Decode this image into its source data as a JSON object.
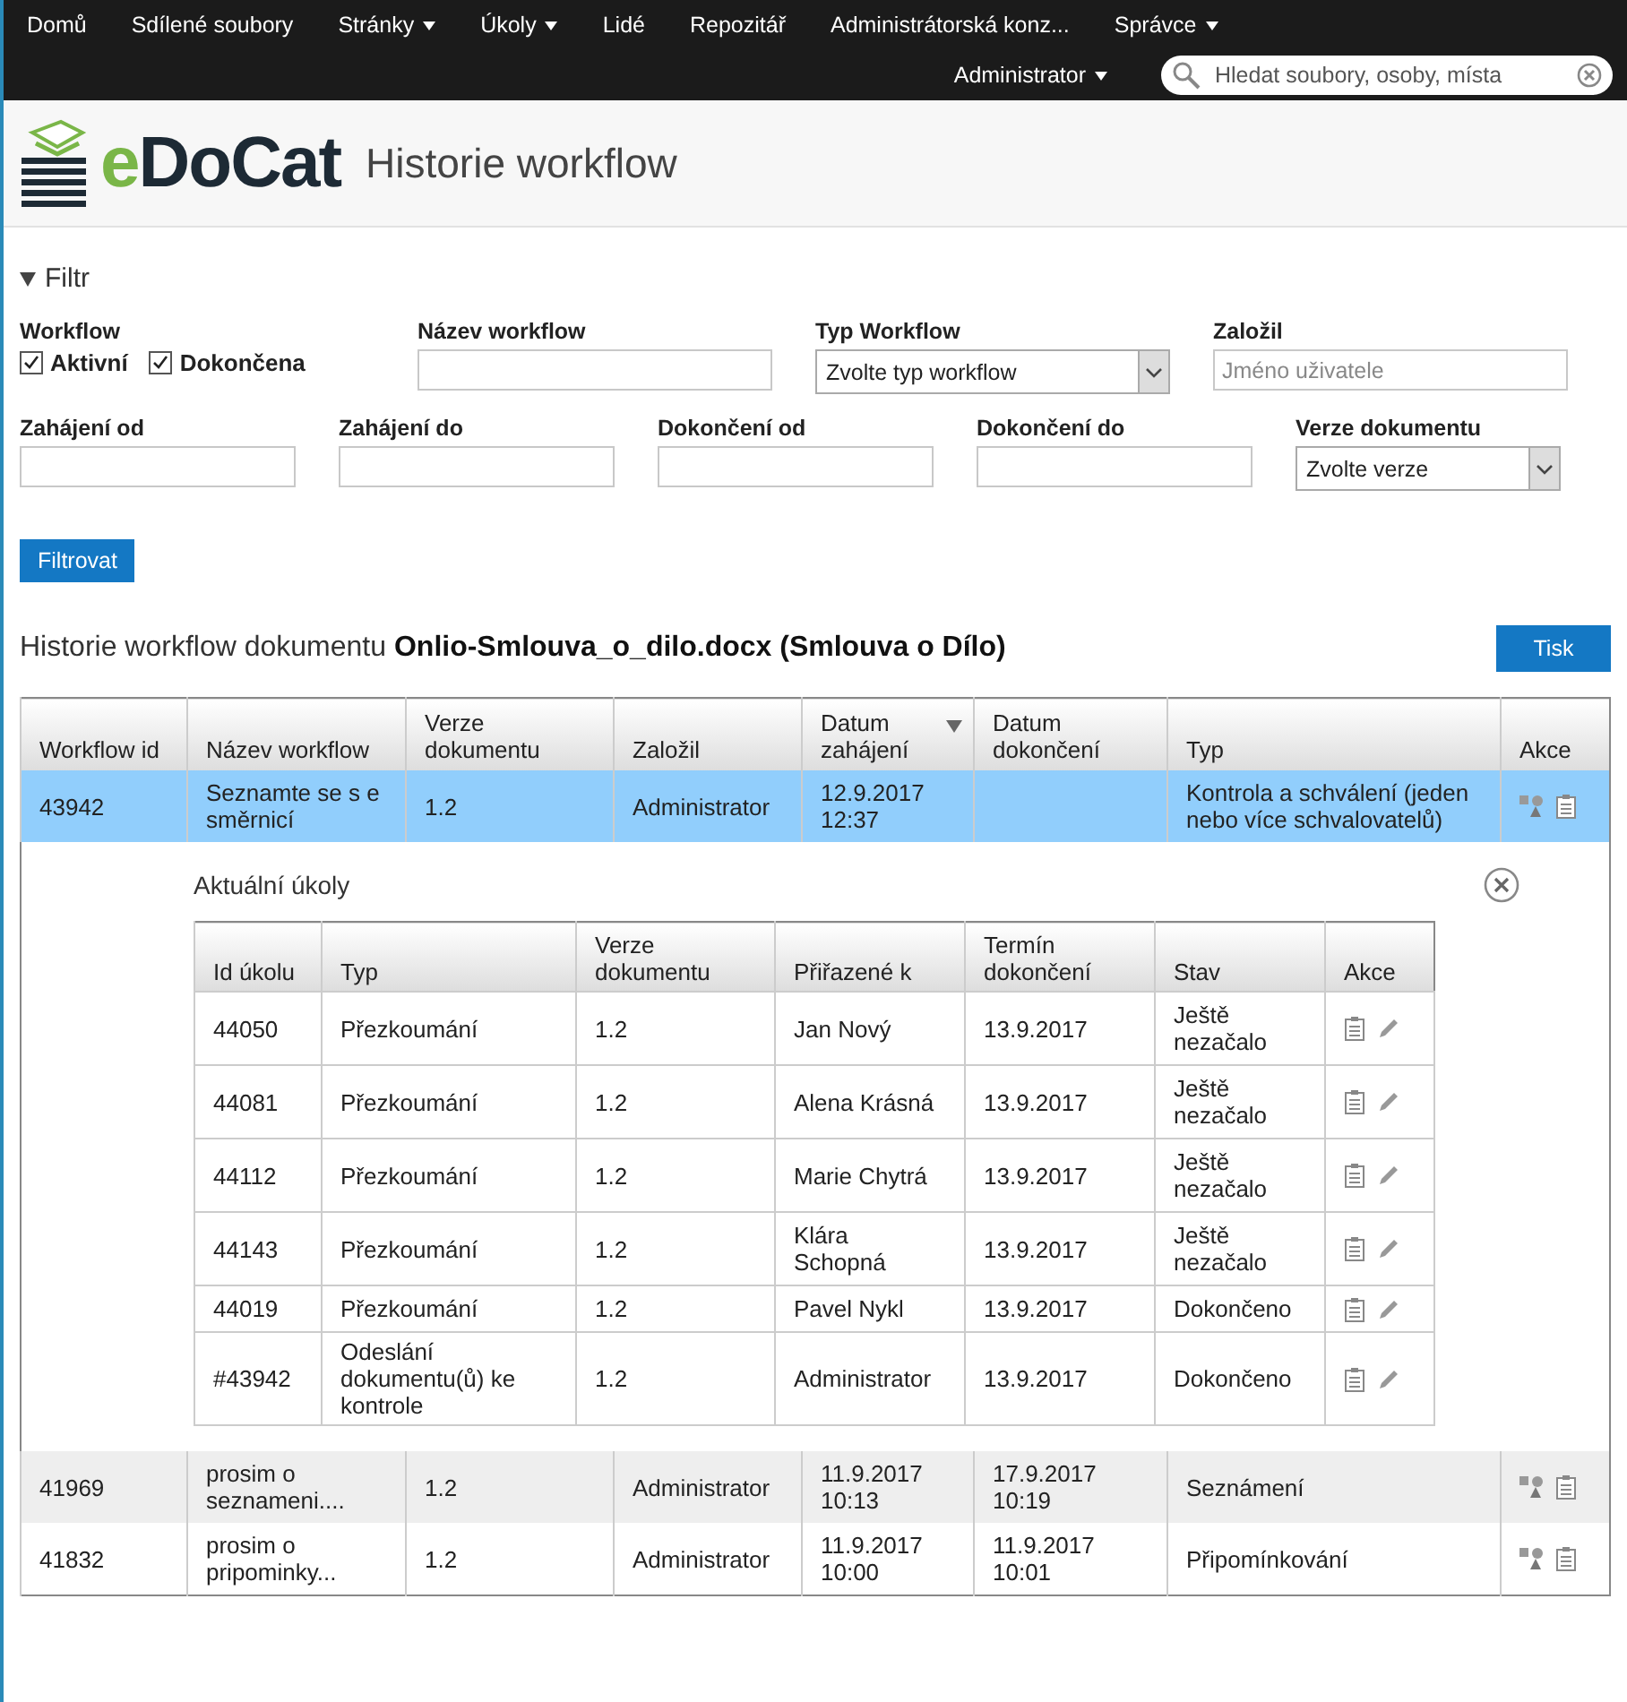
{
  "nav": {
    "items": [
      {
        "label": "Domů",
        "dropdown": false
      },
      {
        "label": "Sdílené soubory",
        "dropdown": false
      },
      {
        "label": "Stránky",
        "dropdown": true
      },
      {
        "label": "Úkoly",
        "dropdown": true
      },
      {
        "label": "Lidé",
        "dropdown": false
      },
      {
        "label": "Repozitář",
        "dropdown": false
      },
      {
        "label": "Administrátorská konz...",
        "dropdown": false
      },
      {
        "label": "Správce",
        "dropdown": true
      }
    ],
    "user": {
      "label": "Administrator",
      "dropdown": true
    },
    "search": {
      "placeholder": "Hledat soubory, osoby, místa"
    }
  },
  "header": {
    "logo": "eDoCat",
    "title": "Historie workflow"
  },
  "filter": {
    "title": "Filtr",
    "expanded": true,
    "workflow": {
      "label": "Workflow",
      "options": [
        {
          "label": "Aktivní",
          "checked": true
        },
        {
          "label": "Dokončena",
          "checked": true
        }
      ]
    },
    "fields": [
      {
        "kind": "text",
        "label": "Název workflow"
      },
      {
        "kind": "select",
        "label": "Typ Workflow",
        "value": "Zvolte typ workflow"
      },
      {
        "kind": "text",
        "label": "Založil",
        "placeholder": "Jméno uživatele"
      },
      {
        "kind": "text",
        "label": "Zahájení od"
      },
      {
        "kind": "text",
        "label": "Zahájení do"
      },
      {
        "kind": "text",
        "label": "Dokončení od"
      },
      {
        "kind": "text",
        "label": "Dokončení do"
      },
      {
        "kind": "select",
        "label": "Verze dokumentu",
        "value": "Zvolte verze"
      }
    ],
    "button": "Filtrovat"
  },
  "history": {
    "title": "Historie workflow dokumentu ",
    "document": "Onlio-Smlouva_o_dilo.docx (Smlouva o Dílo)",
    "print_button": "Tisk",
    "table": {
      "columns": [
        {
          "label": "Workflow id",
          "sorted": false
        },
        {
          "label": "Název workflow",
          "sorted": false
        },
        {
          "label": "Verze dokumentu",
          "sorted": false
        },
        {
          "label": "Založil",
          "sorted": false
        },
        {
          "label": "Datum zahájení",
          "sorted": true
        },
        {
          "label": "Datum dokončení",
          "sorted": false
        },
        {
          "label": "Typ",
          "sorted": false
        },
        {
          "label": "Akce",
          "sorted": false
        }
      ],
      "rows": [
        {
          "selected": true,
          "expanded": true,
          "cells": [
            "43942",
            "Seznamte se s e směrnicí",
            "1.2",
            "Administrator",
            "12.9.2017 12:37",
            "",
            "Kontrola a schválení (jeden nebo více schvalovatelů)"
          ],
          "tasks": {
            "title": "Aktuální úkoly",
            "columns": [
              "Id úkolu",
              "Typ",
              "Verze dokumentu",
              "Přiřazené k",
              "Termín dokončení",
              "Stav",
              "Akce"
            ],
            "rows": [
              [
                "44050",
                "Přezkoumání",
                "1.2",
                "Jan Nový",
                "13.9.2017",
                "Ještě nezačalo"
              ],
              [
                "44081",
                "Přezkoumání",
                "1.2",
                "Alena Krásná",
                "13.9.2017",
                "Ještě nezačalo"
              ],
              [
                "44112",
                "Přezkoumání",
                "1.2",
                "Marie Chytrá",
                "13.9.2017",
                "Ještě nezačalo"
              ],
              [
                "44143",
                "Přezkoumání",
                "1.2",
                "Klára Schopná",
                "13.9.2017",
                "Ještě nezačalo"
              ],
              [
                "44019",
                "Přezkoumání",
                "1.2",
                "Pavel Nykl",
                "13.9.2017",
                "Dokončeno"
              ],
              [
                "#43942",
                "Odeslání dokumentu(ů) ke kontrole",
                "1.2",
                "Administrator",
                "13.9.2017",
                "Dokončeno"
              ]
            ]
          }
        },
        {
          "selected": false,
          "expanded": false,
          "cells": [
            "41969",
            "prosim o seznameni....",
            "1.2",
            "Administrator",
            "11.9.2017 10:13",
            "17.9.2017 10:19",
            "Seznámení"
          ]
        },
        {
          "selected": false,
          "expanded": false,
          "cells": [
            "41832",
            "prosim o pripominky...",
            "1.2",
            "Administrator",
            "11.9.2017 10:00",
            "11.9.2017 10:01",
            "Připomínkování"
          ]
        }
      ]
    }
  }
}
